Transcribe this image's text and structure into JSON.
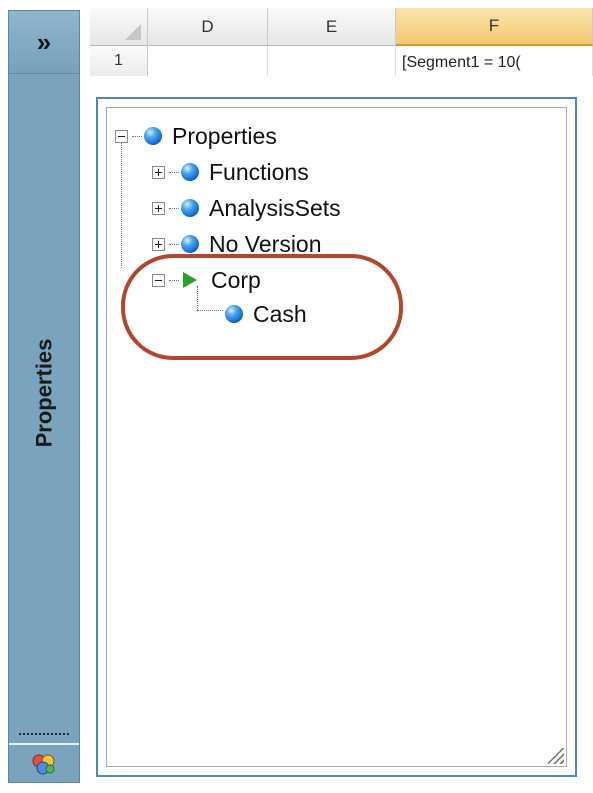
{
  "sidebar": {
    "expand_glyph": "»",
    "title": "Properties",
    "bottom_icon": "add-in-icon"
  },
  "sheet": {
    "columns": [
      "D",
      "E",
      "F"
    ],
    "active_column": "F",
    "rows": [
      {
        "number": "1",
        "cells": [
          "",
          "",
          "[Segment1 = 10("
        ]
      }
    ]
  },
  "tree": {
    "root": {
      "label": "Properties",
      "expanded": true
    },
    "children": [
      {
        "label": "Functions",
        "expanded": false
      },
      {
        "label": "AnalysisSets",
        "expanded": false
      },
      {
        "label": "No Version",
        "expanded": false
      },
      {
        "label": "Corp",
        "expanded": true,
        "icon": "play-icon",
        "children": [
          {
            "label": "Cash"
          }
        ]
      }
    ]
  },
  "colors": {
    "sidebar_bg": "#7aa4bd",
    "panel_border": "#4a86c8",
    "highlight_ring": "#b3462d",
    "active_column": "#f4c96e"
  }
}
